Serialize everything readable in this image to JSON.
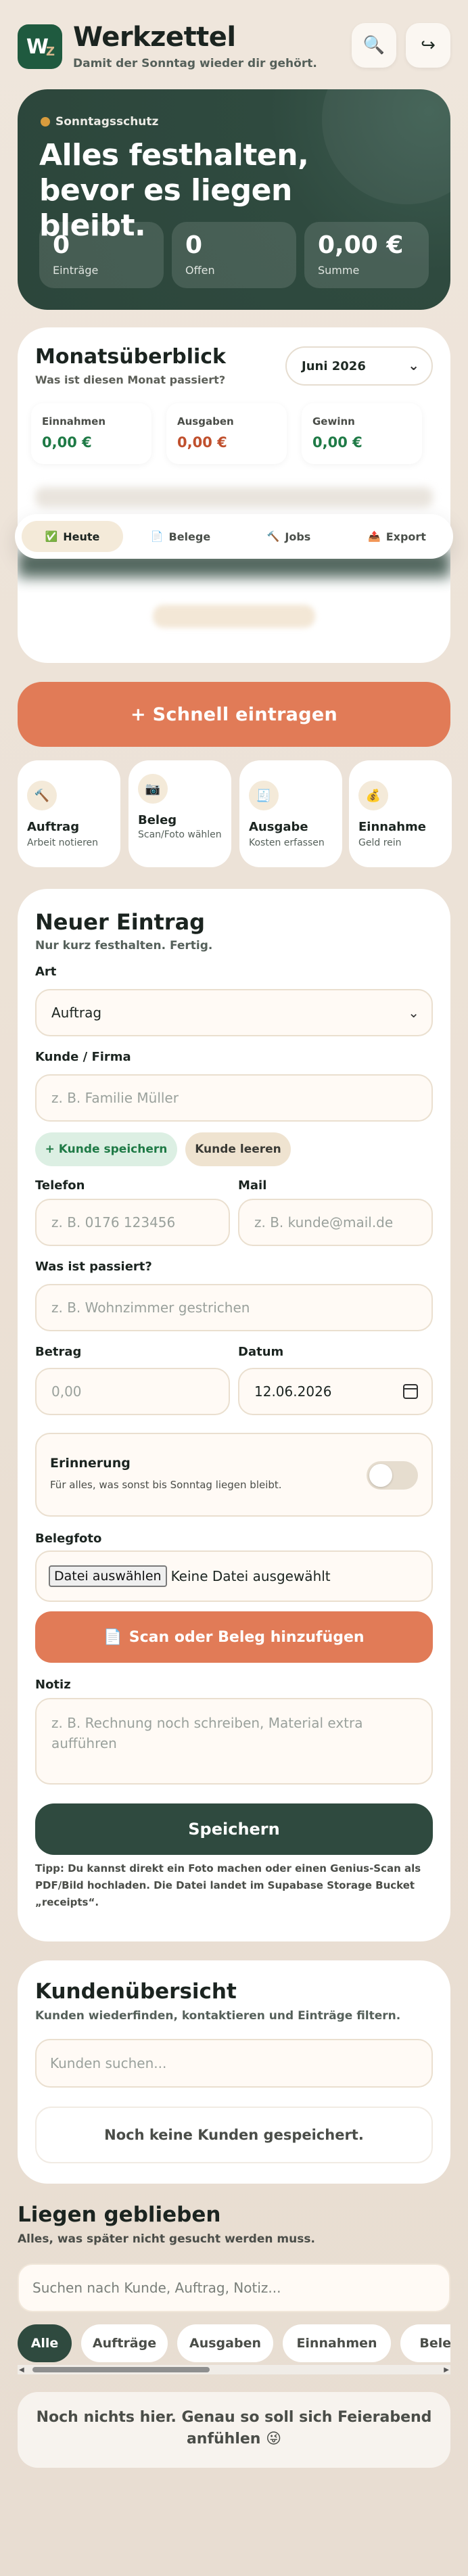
{
  "header": {
    "logo_text": "W",
    "logo_sub": "Z",
    "title": "Werkzettel",
    "subtitle": "Damit der Sonntag wieder dir gehört.",
    "search_icon": "🔍",
    "logout_icon": "↪"
  },
  "hero": {
    "tag": "Sonntagsschutz",
    "title": "Alles festhalten, bevor es liegen bleibt.",
    "stats": [
      {
        "value": "0",
        "label": "Einträge"
      },
      {
        "value": "0",
        "label": "Offen"
      },
      {
        "value": "0,00 €",
        "label": "Summe"
      }
    ]
  },
  "month": {
    "title": "Monatsüberblick",
    "subtitle": "Was ist diesen Monat passiert?",
    "selected": "Juni 2026",
    "cards": [
      {
        "label": "Einnahmen",
        "value": "0,00 €",
        "color": "#1f7a46"
      },
      {
        "label": "Ausgaben",
        "value": "0,00 €",
        "color": "#c0502d"
      },
      {
        "label": "Gewinn",
        "value": "0,00 €",
        "color": "#1f7a46"
      }
    ]
  },
  "nav": {
    "items": [
      {
        "icon": "✅",
        "label": "Heute"
      },
      {
        "icon": "📄",
        "label": "Belege"
      },
      {
        "icon": "🔨",
        "label": "Jobs"
      },
      {
        "icon": "📤",
        "label": "Export"
      }
    ]
  },
  "quick": {
    "label": "+ Schnell eintragen"
  },
  "tiles": [
    {
      "icon": "🔨",
      "title": "Auftrag",
      "subtitle": "Arbeit notieren"
    },
    {
      "icon": "📷",
      "title": "Beleg",
      "subtitle": "Scan/Foto wählen"
    },
    {
      "icon": "🧾",
      "title": "Ausgabe",
      "subtitle": "Kosten erfassen"
    },
    {
      "icon": "💰",
      "title": "Einnahme",
      "subtitle": "Geld rein"
    }
  ],
  "form": {
    "title": "Neuer Eintrag",
    "subtitle": "Nur kurz festhalten. Fertig.",
    "type_label": "Art",
    "type_value": "Auftrag",
    "customer_label": "Kunde / Firma",
    "customer_placeholder": "z. B. Familie Müller",
    "save_customer": "+ Kunde speichern",
    "clear_customer": "Kunde leeren",
    "phone_label": "Telefon",
    "phone_placeholder": "z. B. 0176 123456",
    "mail_label": "Mail",
    "mail_placeholder": "z. B. kunde@mail.de",
    "what_label": "Was ist passiert?",
    "what_placeholder": "z. B. Wohnzimmer gestrichen",
    "amount_label": "Betrag",
    "amount_placeholder": "0,00",
    "date_label": "Datum",
    "date_value": "12.06.2026",
    "reminder_title": "Erinnerung",
    "reminder_sub": "Für alles, was sonst bis Sonntag liegen bleibt.",
    "reminder_on": false,
    "photo_label": "Belegfoto",
    "file_button": "Datei auswählen",
    "file_status": "Keine Datei ausgewählt",
    "scan_icon": "📄",
    "scan_label": "Scan oder Beleg hinzufügen",
    "note_label": "Notiz",
    "note_placeholder": "z. B. Rechnung noch schreiben, Material extra aufführen",
    "save_label": "Speichern",
    "tip": "Tipp: Du kannst direkt ein Foto machen oder einen Genius-Scan als PDF/Bild hochladen. Die Datei landet im Supabase Storage Bucket „receipts“."
  },
  "customers": {
    "title": "Kundenübersicht",
    "subtitle": "Kunden wiederfinden, kontaktieren und Einträge filtern.",
    "search_placeholder": "Kunden suchen...",
    "empty": "Noch keine Kunden gespeichert."
  },
  "pending": {
    "title": "Liegen geblieben",
    "subtitle": "Alles, was später nicht gesucht werden muss.",
    "search_placeholder": "Suchen nach Kunde, Auftrag, Notiz...",
    "filters": [
      "Alle",
      "Aufträge",
      "Ausgaben",
      "Einnahmen",
      "Belege"
    ],
    "empty": "Noch nichts hier. Genau so soll sich Feierabend anfühlen 😜"
  }
}
